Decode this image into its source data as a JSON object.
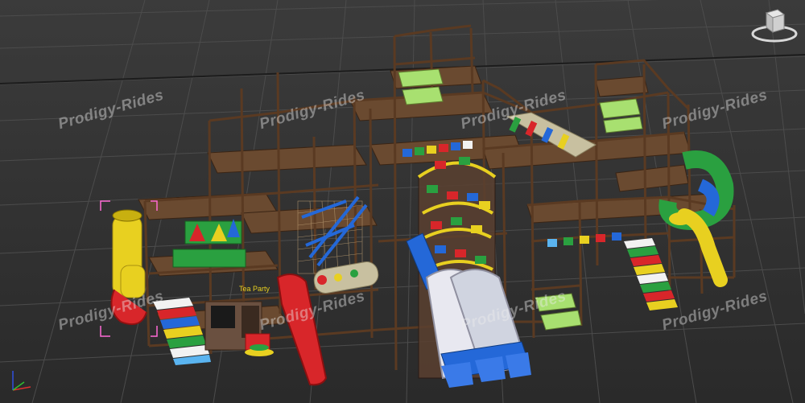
{
  "viewport": {
    "background": "#333333",
    "grid_color": "#4a4a4a"
  },
  "watermarks": [
    "Prodigy-Rides",
    "Prodigy-Rides",
    "Prodigy-Rides",
    "Prodigy-Rides",
    "Prodigy-Rides",
    "Prodigy-Rides",
    "Prodigy-Rides",
    "Prodigy-Rides"
  ],
  "structure": {
    "frame_color": "#5a3a22",
    "deck_color": "#6a4a30",
    "sign_text": "Tea Party"
  },
  "colors": {
    "red": "#d8262a",
    "yellow": "#e8d020",
    "blue": "#2468d8",
    "green": "#2aa040",
    "light_blue": "#5ab4f0",
    "net_green": "#a8e070",
    "white": "#f2f2f2"
  },
  "viewcube": {
    "icon": "viewcube-icon"
  },
  "axis_gizmo": {
    "icon": "axis-tripod-icon"
  }
}
